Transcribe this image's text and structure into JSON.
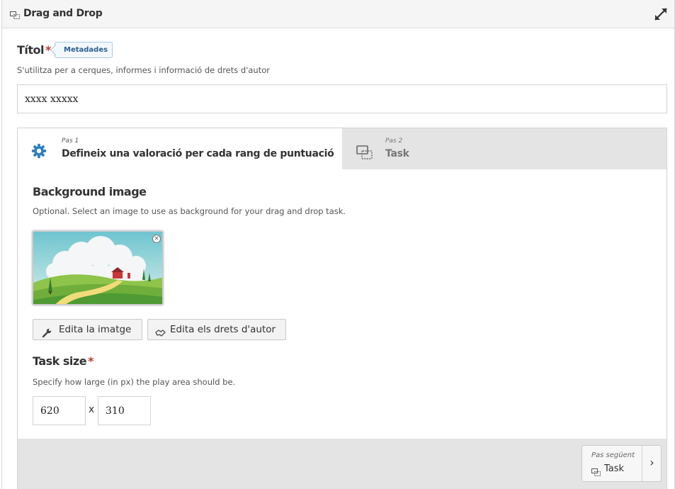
{
  "header": {
    "title": "Drag and Drop",
    "content_type_icon": "drag-drop-icon",
    "expand_icon": "fullscreen-expand-icon"
  },
  "title_field": {
    "label": "Títol",
    "required_marker": "*",
    "metadata_button": "Metadades",
    "description": "S'utilitza per a cerques, informes i informació de drets d'autor",
    "value": "xxxx xxxxx"
  },
  "wizard": {
    "steps": [
      {
        "step_label": "Pas 1",
        "title": "Defineix una valoració per cada rang de puntuació",
        "icon": "gear-icon",
        "active": true
      },
      {
        "step_label": "Pas 2",
        "title": "Task",
        "icon": "drag-drop-icon",
        "active": false
      }
    ],
    "background_image": {
      "title": "Background image",
      "description": "Optional. Select an image to use as background for your drag and drop task.",
      "remove_icon": "close-icon",
      "edit_image_label": "Edita la imatge",
      "edit_image_icon": "wrench-icon",
      "edit_copyright_label": "Edita els drets d'autor",
      "edit_copyright_icon": "handshake-icon"
    },
    "task_size": {
      "title": "Task size",
      "required_marker": "*",
      "description": "Specify how large (in px) the play area should be.",
      "width": "620",
      "separator": "x",
      "height": "310"
    },
    "footer": {
      "next_small": "Pas següent",
      "next_label": "Task",
      "next_arrow": "›"
    }
  },
  "colors": {
    "accent_blue": "#2d7fc1",
    "required_red": "#c0392b",
    "tab_bar": "#e4e4e4"
  }
}
